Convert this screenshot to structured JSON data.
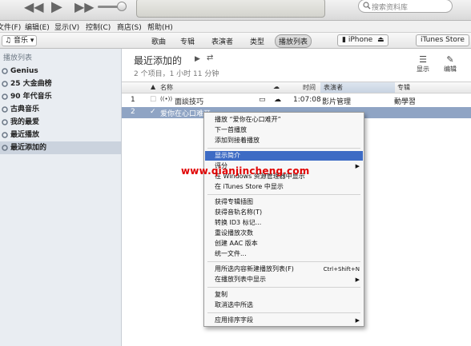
{
  "toolbar": {
    "prev_icon": "rewind-icon",
    "play_icon": "play-icon",
    "next_icon": "fast-forward-icon",
    "search_placeholder": "搜索资料库"
  },
  "menubar": [
    "文件(F)",
    "编辑(E)",
    "显示(V)",
    "控制(C)",
    "商店(S)",
    "帮助(H)"
  ],
  "navbar": {
    "library": "音乐",
    "tabs": [
      "歌曲",
      "专辑",
      "表演者",
      "类型",
      "播放列表"
    ],
    "active_tab": "播放列表",
    "device": "iPhone",
    "store": "iTunes Store"
  },
  "sidebar": {
    "heading": "播放列表",
    "items": [
      "Genius",
      "25 大金曲榜",
      "90 年代音乐",
      "古典音乐",
      "我的最爱",
      "最近播放",
      "最近添加的"
    ],
    "selected": "最近添加的"
  },
  "header": {
    "title": "最近添加的",
    "summary": "2 个项目，1 小时 11 分钟",
    "view_label": "显示",
    "edit_label": "编辑"
  },
  "columns": {
    "name": "名称",
    "time": "时间",
    "artist": "表演者",
    "album": "专辑"
  },
  "rows": [
    {
      "num": "1",
      "name": "面談技巧",
      "time": "1:07:08",
      "artist": "影片管理",
      "album": "動學習"
    },
    {
      "num": "2",
      "name": "爱你在心口难开",
      "time": "",
      "artist": "",
      "album": ""
    }
  ],
  "context_menu": {
    "items": [
      {
        "label": "播放 “爱你在心口难开”"
      },
      {
        "label": "下一首播放"
      },
      {
        "label": "添加到接着播放"
      },
      {
        "label": "显示简介",
        "highlighted": true
      },
      {
        "label": "评分",
        "submenu": true
      },
      {
        "label": "在 Windows 资源管理器中显示"
      },
      {
        "label": "在 iTunes Store 中显示"
      },
      {
        "label": "获得专辑插图"
      },
      {
        "label": "获得音轨名称(T)"
      },
      {
        "label": "转换 ID3 标记..."
      },
      {
        "label": "重设播放次数"
      },
      {
        "label": "创建 AAC 版本"
      },
      {
        "label": "统一文件..."
      },
      {
        "label": "用所选内容新建播放列表(F)",
        "shortcut": "Ctrl+Shift+N"
      },
      {
        "label": "在播放列表中显示",
        "submenu": true
      },
      {
        "label": "复制"
      },
      {
        "label": "取消选中所选"
      },
      {
        "label": "应用排序字段",
        "submenu": true
      }
    ]
  },
  "watermark": "www.qianjincheng.com",
  "colors": {
    "highlight": "#3d6bc4",
    "selected_row": "#8fa4c4",
    "watermark": "#e00000"
  }
}
